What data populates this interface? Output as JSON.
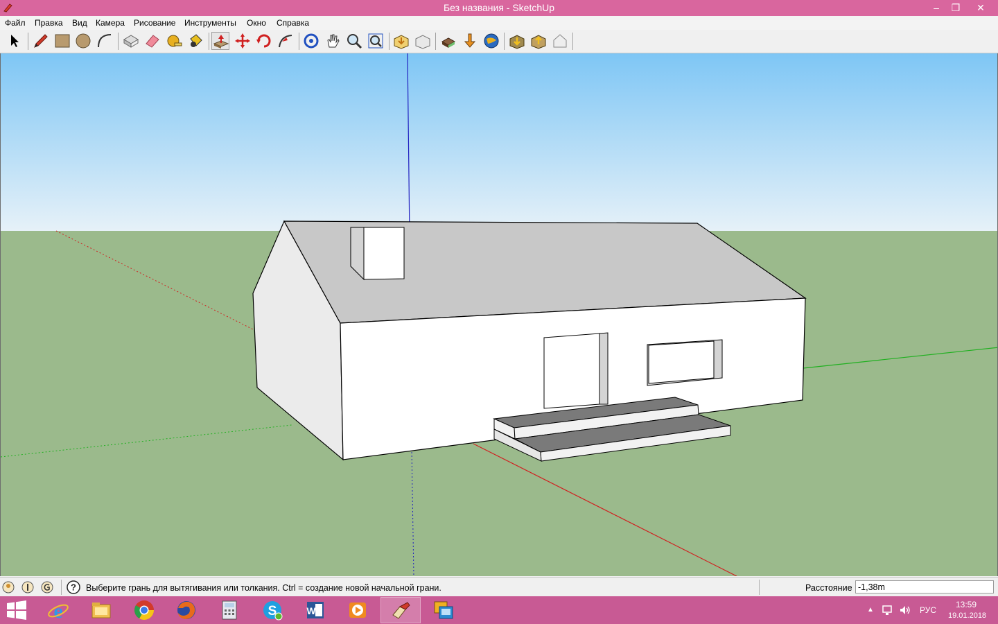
{
  "window": {
    "title": "Без названия - SketchUp",
    "controls": {
      "minimize": "–",
      "restore": "❐",
      "close": "✕"
    }
  },
  "menu": [
    "Файл",
    "Правка",
    "Вид",
    "Камера",
    "Рисование",
    "Инструменты",
    "Окно",
    "Справка"
  ],
  "toolbar": {
    "tools": [
      "select-icon",
      "pencil-icon",
      "rectangle-icon",
      "circle-icon",
      "arc-icon",
      "make-component-icon",
      "eraser-icon",
      "tape-measure-icon",
      "paint-bucket-icon",
      "push-pull-icon",
      "move-icon",
      "rotate-icon",
      "follow-me-icon",
      "orbit-icon",
      "pan-icon",
      "zoom-icon",
      "zoom-extents-icon",
      "get-models-icon",
      "share-model-icon",
      "3d-warehouse-icon",
      "extension-warehouse-icon",
      "google-earth-icon",
      "geo-location-icon",
      "preview-icon",
      "photo-textures-icon"
    ],
    "active_tool": "push-pull-icon"
  },
  "status": {
    "indicators": [
      "geo-location-status-icon",
      "credits-status-icon",
      "user-status-icon"
    ],
    "message": "Выберите грань для вытягивания или толкания.  Ctrl = создание новой начальной грани.",
    "measurement_label": "Расстояние",
    "measurement_value": "-1,38m"
  },
  "taskbar": {
    "apps": [
      "start-icon",
      "internet-explorer-icon",
      "file-explorer-icon",
      "chrome-icon",
      "firefox-icon",
      "calculator-icon",
      "skype-icon",
      "word-icon",
      "media-player-icon",
      "sketchup-icon",
      "layout-icon"
    ],
    "active_app": "sketchup-icon",
    "language": "РУС",
    "time": "13:59",
    "date": "19.01.2018"
  },
  "colors": {
    "titlebar": "#d9669e",
    "taskbar": "#c85a94",
    "sky_top": "#7ec6f5",
    "sky_bottom": "#e6f1f8",
    "ground": "#9bba8c",
    "axis_red": "#d02020",
    "axis_green": "#20b020",
    "axis_blue": "#2020c0"
  }
}
